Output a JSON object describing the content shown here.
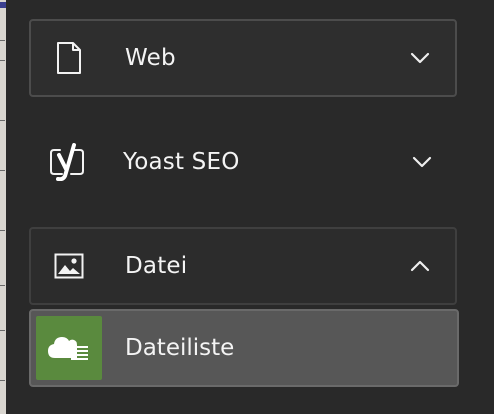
{
  "menu": {
    "items": [
      {
        "label": "Web",
        "icon": "page-icon",
        "expanded": false
      },
      {
        "label": "Yoast SEO",
        "icon": "yoast-icon",
        "expanded": false
      },
      {
        "label": "Datei",
        "icon": "image-icon",
        "expanded": true
      }
    ],
    "subitems": [
      {
        "label": "Dateiliste",
        "icon": "cloud-list-icon",
        "accent": "#5a8a3e"
      }
    ]
  }
}
